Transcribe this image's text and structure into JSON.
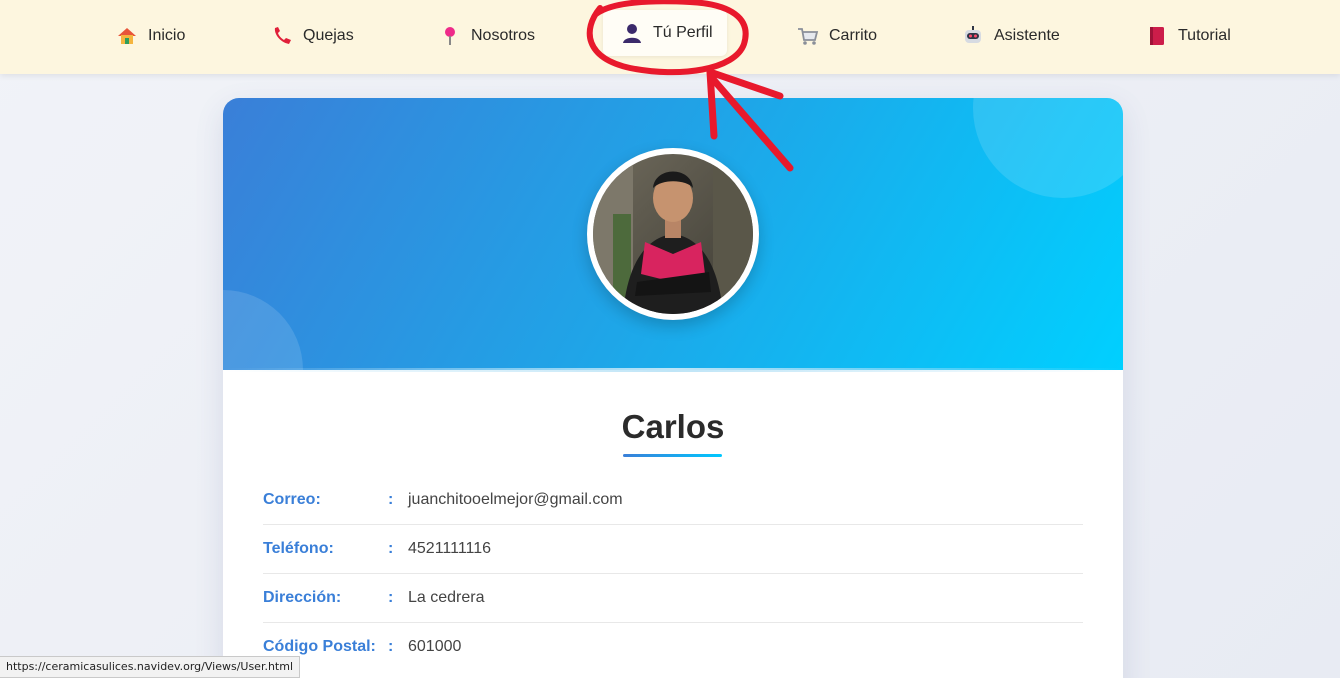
{
  "nav": {
    "items": [
      {
        "label": "Inicio",
        "icon": "home-icon"
      },
      {
        "label": "Quejas",
        "icon": "phone-icon"
      },
      {
        "label": "Nosotros",
        "icon": "pin-icon"
      },
      {
        "label": "Tú Perfil",
        "icon": "user-icon",
        "active": true
      },
      {
        "label": "Carrito",
        "icon": "cart-icon"
      },
      {
        "label": "Asistente",
        "icon": "robot-icon"
      },
      {
        "label": "Tutorial",
        "icon": "book-icon"
      }
    ]
  },
  "profile": {
    "name": "Carlos",
    "fields": [
      {
        "label": "Correo:",
        "sep": ":",
        "value": "juanchitooelmejor@gmail.com"
      },
      {
        "label": "Teléfono:",
        "sep": ":",
        "value": "4521111116"
      },
      {
        "label": "Dirección:",
        "sep": ":",
        "value": "La cedrera"
      },
      {
        "label": "Código Postal:",
        "sep": ":",
        "value": "601000"
      }
    ]
  },
  "status_bar": {
    "url": "https://ceramicasulices.navidev.org/Views/User.html"
  },
  "colors": {
    "nav_bg": "#fdf6df",
    "accent": "#3a7fd8",
    "banner_start": "#3a7fd8",
    "banner_end": "#00d0ff",
    "annotation": "#e8192c"
  }
}
